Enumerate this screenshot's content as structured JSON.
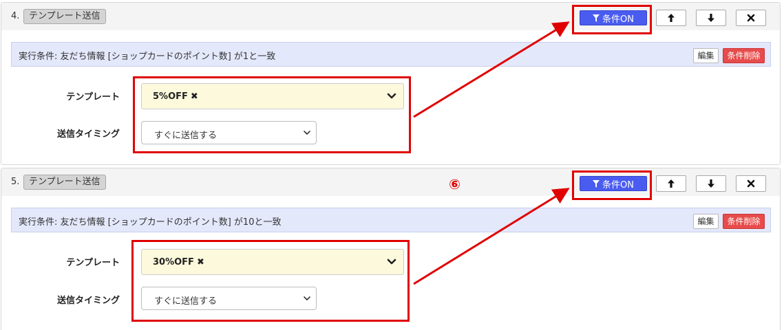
{
  "steps": [
    {
      "number": "4.",
      "action": "テンプレート送信",
      "cond_button": "条件ON",
      "condition_text": "実行条件: 友だち情報 [ショップカードのポイント数] が1と一致",
      "edit_label": "編集",
      "cond_delete_label": "条件削除",
      "template_label": "テンプレート",
      "template_value": "5%OFF",
      "timing_label": "送信タイミング",
      "timing_value": "すぐに送信する"
    },
    {
      "number": "5.",
      "action": "テンプレート送信",
      "cond_button": "条件ON",
      "condition_text": "実行条件: 友だち情報 [ショップカードのポイント数] が10と一致",
      "edit_label": "編集",
      "cond_delete_label": "条件削除",
      "template_label": "テンプレート",
      "template_value": "30%OFF",
      "timing_label": "送信タイミング",
      "timing_value": "すぐに送信する"
    }
  ],
  "remove_glyph": "✖",
  "annotation_marker": "⑥",
  "icons": {
    "filter": "funnel-icon",
    "up": "arrow-up-icon",
    "down": "arrow-down-icon",
    "delete": "close-icon",
    "select": "chevron-down-icon"
  },
  "colors": {
    "accent": "#4a5cf0",
    "danger": "#e74c4c",
    "highlight": "#e00000",
    "template_bg": "#fcf9dc",
    "condition_bg": "#e4e8fb"
  }
}
